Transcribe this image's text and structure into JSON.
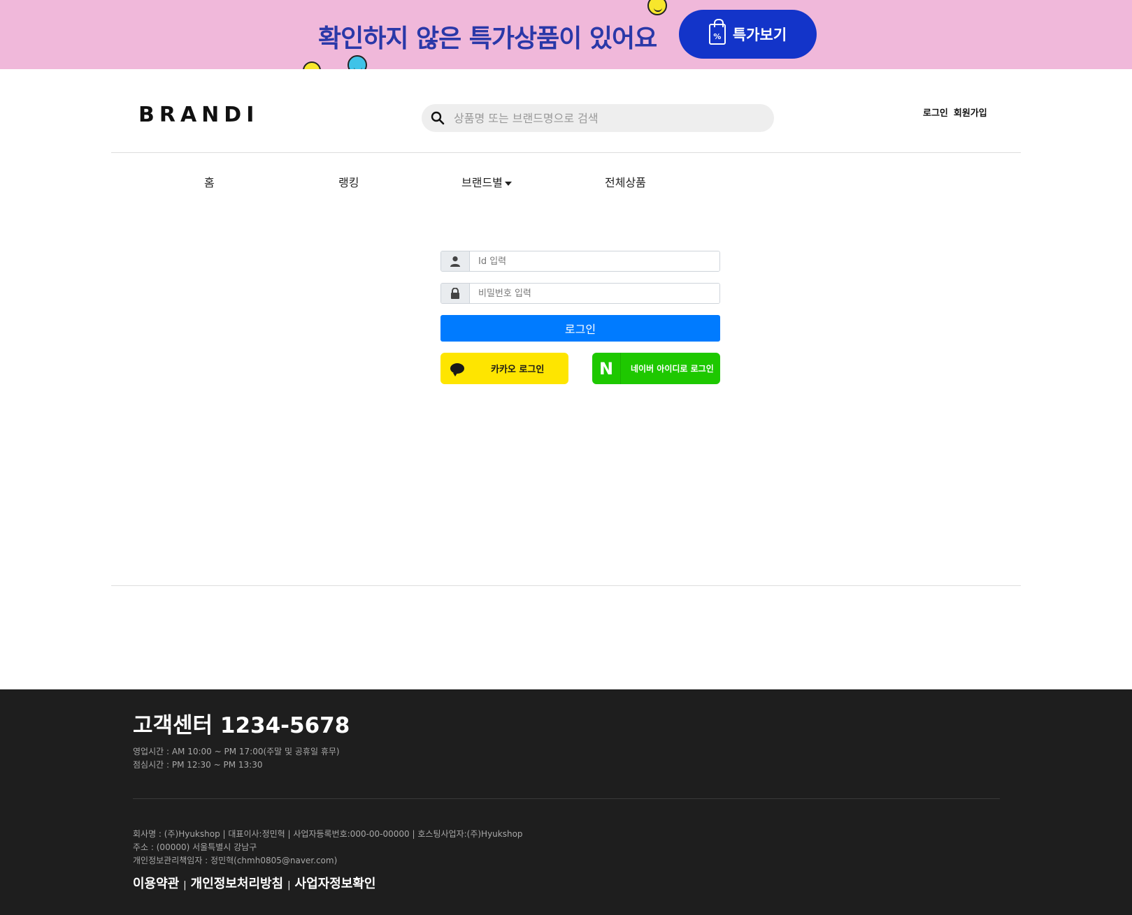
{
  "promo": {
    "text": "확인하지 않은 특가상품이 있어요",
    "button_label": "특가보기",
    "bag_glyph": "%",
    "colors": {
      "background": "#f0b8da",
      "text": "#2a38a8",
      "button": "#1334c9"
    }
  },
  "header": {
    "logo": "BRANDI",
    "search_placeholder": "상품명 또는 브랜드명으로 검색",
    "login_link": "로그인",
    "signup_link": "회원가입"
  },
  "nav": {
    "items": [
      "홈",
      "랭킹",
      "브랜드별",
      "전체상품"
    ]
  },
  "login_form": {
    "id_placeholder": "Id 입력",
    "password_placeholder": "비밀번호 입력",
    "submit_label": "로그인",
    "kakao_label": "카카오 로그인",
    "naver_glyph": "N",
    "naver_label": "네이버 아이디로 로그인",
    "colors": {
      "primary": "#007bff",
      "kakao": "#fee500",
      "naver": "#1ec800"
    }
  },
  "footer": {
    "cs_title": "고객센터 1234-5678",
    "business_hours": "영업시간 : AM 10:00 ~ PM 17:00(주말 및 공휴일 휴무)",
    "lunch_hours": "점심시간 : PM 12:30 ~ PM 13:30",
    "company_line": "회사명 : (주)Hyukshop | 대표이사:정민혁 | 사업자등록번호:000-00-00000 | 호스팅사업자:(주)Hyukshop",
    "address_line": "주소 : (00000) 서울특별시 강남구",
    "privacy_officer_line": "개인정보관리책임자 : 정민혁(chmh0805@naver.com)",
    "links": [
      "이용약관",
      "개인정보처리방침",
      "사업자정보확인"
    ],
    "link_separator": "|",
    "colors": {
      "background": "#1e1e1e"
    }
  }
}
